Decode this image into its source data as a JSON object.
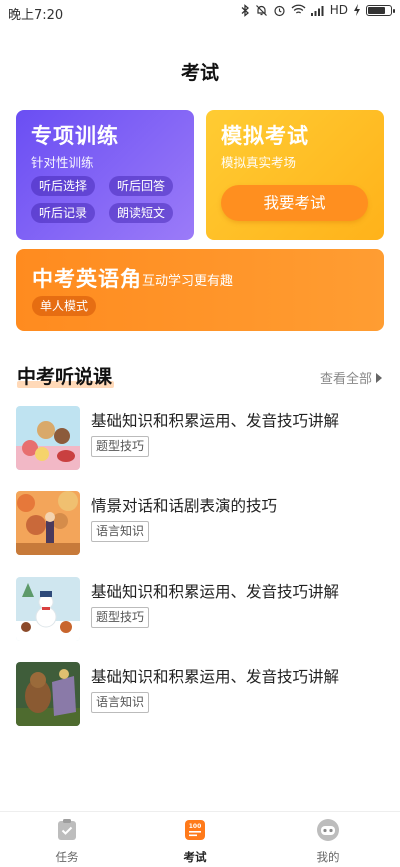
{
  "status_bar": {
    "time": "晚上7:20",
    "network": "HD"
  },
  "header": {
    "title": "考试"
  },
  "cards": {
    "special_training": {
      "title": "专项训练",
      "subtitle": "针对性训练",
      "items": [
        "听后选择",
        "听后回答",
        "听后记录",
        "朗读短文"
      ]
    },
    "mock_exam": {
      "title": "模拟考试",
      "subtitle": "模拟真实考场",
      "button": "我要考试"
    },
    "english_corner": {
      "title": "中考英语角",
      "subtitle": "互动学习更有趣",
      "mode": "单人模式"
    }
  },
  "section": {
    "title": "中考听说课",
    "view_all": "查看全部"
  },
  "courses": [
    {
      "title": "基础知识和积累运用、发音技巧讲解",
      "tag": "题型技巧"
    },
    {
      "title": "情景对话和话剧表演的技巧",
      "tag": "语言知识"
    },
    {
      "title": "基础知识和积累运用、发音技巧讲解",
      "tag": "题型技巧"
    },
    {
      "title": "基础知识和积累运用、发音技巧讲解",
      "tag": "语言知识"
    }
  ],
  "bottom_nav": [
    {
      "label": "任务",
      "icon": "clipboard-check-icon"
    },
    {
      "label": "考试",
      "icon": "exam-100-icon",
      "active": true
    },
    {
      "label": "我的",
      "icon": "robot-face-icon"
    }
  ],
  "colors": {
    "purple_card": "#7a5cf5",
    "yellow_card": "#ffc02a",
    "orange_card": "#ff8f24",
    "accent_orange": "#ff8f1f"
  }
}
